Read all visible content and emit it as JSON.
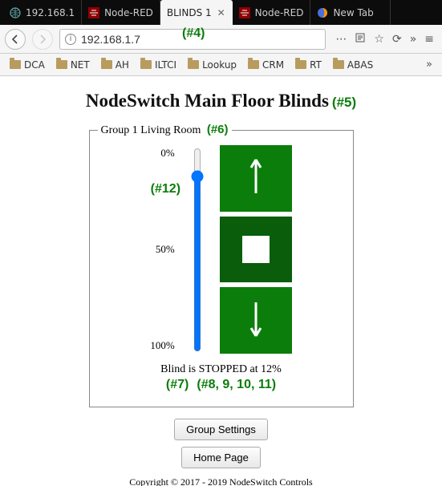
{
  "browser": {
    "tabs": [
      {
        "label": "192.168.1",
        "favicon": "globe"
      },
      {
        "label": "Node-RED",
        "favicon": "nodered"
      },
      {
        "label": "BLINDS 1",
        "favicon": "none",
        "active": true
      },
      {
        "label": "Node-RED",
        "favicon": "nodered"
      },
      {
        "label": "New Tab",
        "favicon": "firefox"
      }
    ],
    "url": "192.168.1.7",
    "bookmarks": [
      "DCA",
      "NET",
      "AH",
      "ILTCI",
      "Lookup",
      "CRM",
      "RT",
      "ABAS"
    ]
  },
  "page": {
    "title": "NodeSwitch Main Floor Blinds",
    "group": {
      "legend": "Group 1 Living Room",
      "ticks": {
        "top": "0%",
        "mid": "50%",
        "bot": "100%"
      },
      "slider_value": 12,
      "status": "Blind is STOPPED at 12%"
    },
    "buttons": {
      "group_settings": "Group Settings",
      "home_page": "Home Page"
    },
    "copyright": "Copyright © 2017 - 2019 NodeSwitch Controls"
  },
  "annotations": {
    "a4": "(#4)",
    "a5": "(#5)",
    "a6": "(#6)",
    "a7": "(#7)",
    "a8_11": "(#8, 9, 10, 11)",
    "a12": "(#12)"
  }
}
